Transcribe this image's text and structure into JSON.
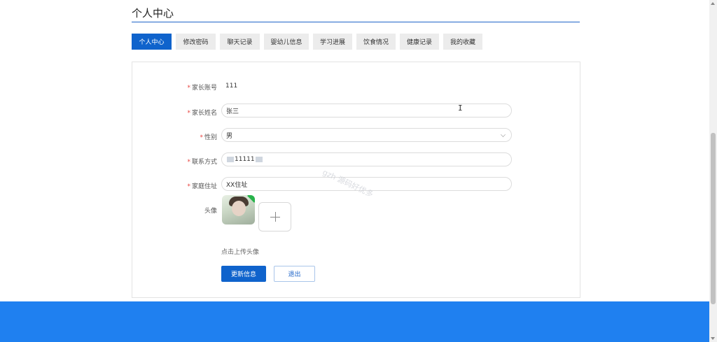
{
  "page": {
    "title": "个人中心"
  },
  "tabs": [
    {
      "label": "个人中心",
      "active": true
    },
    {
      "label": "修改密码"
    },
    {
      "label": "聊天记录"
    },
    {
      "label": "婴幼儿信息"
    },
    {
      "label": "学习进展"
    },
    {
      "label": "饮食情况"
    },
    {
      "label": "健康记录"
    },
    {
      "label": "我的收藏"
    }
  ],
  "form": {
    "required_mark": "*",
    "account": {
      "label": "家长账号",
      "value": "111"
    },
    "name": {
      "label": "家长姓名",
      "value": "张三"
    },
    "gender": {
      "label": "性别",
      "value": "男"
    },
    "phone": {
      "label": "联系方式",
      "value": "11111"
    },
    "address": {
      "label": "家庭住址",
      "value": "XX住址"
    },
    "avatar": {
      "label": "头像",
      "hint": "点击上传头像"
    }
  },
  "buttons": {
    "update": "更新信息",
    "logout": "退出"
  },
  "watermark": "gzh 源码好优多",
  "colors": {
    "primary": "#0f63cc",
    "footer": "#1f80f0",
    "required": "#e8433f"
  }
}
